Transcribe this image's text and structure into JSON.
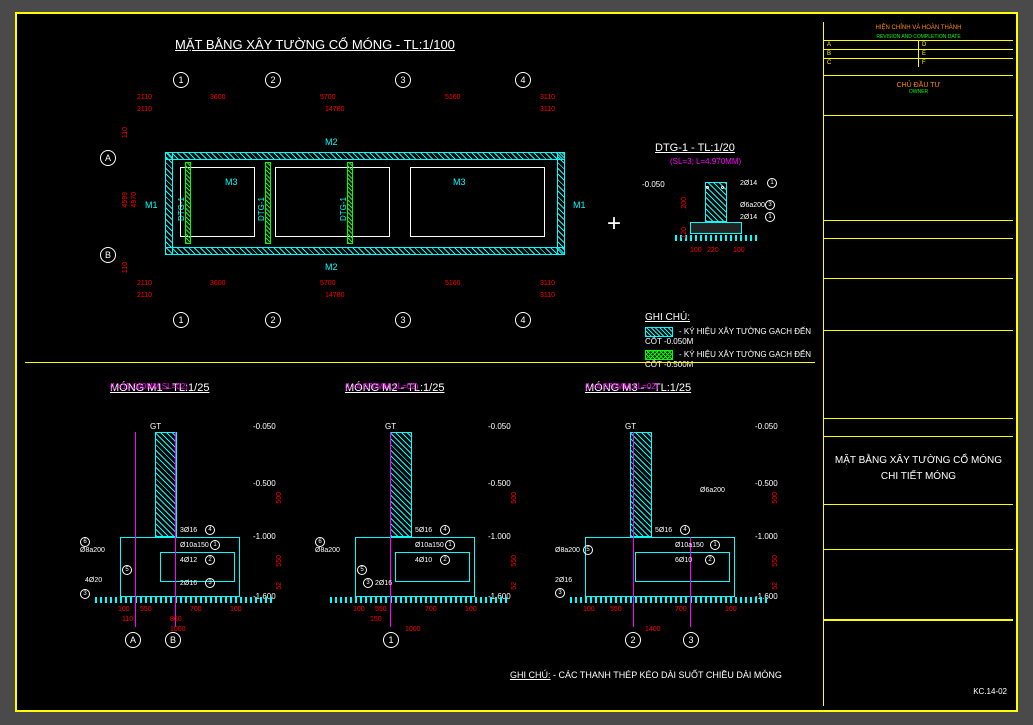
{
  "plan": {
    "title": "MẶT BẰNG XÂY TƯỜNG CỔ MÓNG - TL:1/100",
    "grids_h": [
      "1",
      "2",
      "3",
      "4"
    ],
    "grids_v": [
      "A",
      "B"
    ],
    "dims_top": [
      "2110",
      "3600",
      "5700",
      "5160",
      "3110"
    ],
    "dims_top_inner": [
      "2110",
      "14780",
      "3110"
    ],
    "labels": {
      "m1": "M1",
      "m2": "M2",
      "m3": "M3",
      "dtg": "DTG-1"
    },
    "dims_left": [
      "110",
      "4599",
      "4970",
      "110"
    ]
  },
  "dtg": {
    "title": "DTG-1 - TL:1/20",
    "sub": "(SL=3; L=4.970MM)",
    "elev": "-0.050",
    "r1": "2Ø14",
    "r2": "Ø6a200",
    "r3": "2Ø14",
    "d1": "220",
    "d2": "100",
    "d3": "100",
    "d4": "200",
    "d5": "120"
  },
  "legend": {
    "title": "GHI CHÚ:",
    "i1": "- KÝ HIỆU XÂY TƯỜNG GẠCH ĐẾN CỐT -0.050M",
    "i2": "- KÝ HIỆU XÂY TƯỜNG GẠCH ĐẾN CỐT -0.500M"
  },
  "m1": {
    "title": "MÓNG M1 - TL:1/25",
    "sub": "(L=15.000MM,SL=02)",
    "gt": "GT",
    "e1": "-0.050",
    "e2": "-0.500",
    "e3": "-1.000",
    "e4": "-1.600",
    "r1": "3Ø16",
    "r2": "Ø10a150",
    "r3": "4Ø12",
    "r4": "4Ø20",
    "r5": "2Ø16",
    "r6": "Ø8a200",
    "d1": "100",
    "d2": "550",
    "d3": "700",
    "d4": "100",
    "d5": "110",
    "d6": "860",
    "d7": "1000",
    "d8": "500",
    "d9": "550",
    "d10": "52",
    "d11": "200"
  },
  "m2": {
    "title": "MÓNG M2 - TL:1/25",
    "sub": "(L=4.970MM,SL=02)",
    "gt": "GT",
    "e1": "-0.050",
    "e2": "-0.500",
    "e3": "-1.000",
    "e4": "-1.600",
    "r1": "5Ø16",
    "r2": "Ø10a150",
    "r3": "4Ø10",
    "r4": "2Ø16",
    "r5": "Ø8a200",
    "d1": "100",
    "d2": "550",
    "d3": "700",
    "d4": "100",
    "d5": "150",
    "d6": "1000",
    "d7": "500",
    "d8": "550",
    "d9": "52",
    "d10": "200"
  },
  "m3": {
    "title": "MÓNG M3 -  - TL:1/25",
    "sub": "(L=4.970MM,SL=02)",
    "gt": "GT",
    "e1": "-0.050",
    "e2": "-0.500",
    "e3": "-1.000",
    "e4": "-1.600",
    "r1": "5Ø16",
    "r2": "Ø10a150",
    "r3": "6Ø10",
    "r4": "2Ø16",
    "r5": "Ø8a200",
    "r6": "Ø6a200",
    "d1": "100",
    "d2": "550",
    "d3": "700",
    "d4": "100",
    "d5": "1400",
    "d6": "500",
    "d7": "550",
    "d8": "52",
    "d9": "200"
  },
  "footnote": {
    "t": "GHI CHÚ:",
    "txt": "- CÁC THANH THÉP KÉO DÀI SUỐT CHIỀU DÀI MÓNG"
  },
  "titleblock": {
    "hdr1": "HIỆN CHỈNH VÀ HOÀN THÀNH",
    "hdr2": "REVISION AND COMPLETION DATE",
    "rows": [
      "A",
      "B",
      "C"
    ],
    "cols": [
      "D",
      "E",
      "F"
    ],
    "owner": "CHỦ ĐẦU TƯ",
    "owner2": "OWNER",
    "main1": "MẶT BẰNG XÂY TƯỜNG CỔ MÓNG",
    "main2": "CHI TIẾT MÓNG",
    "sheet": "KC.14-02"
  }
}
